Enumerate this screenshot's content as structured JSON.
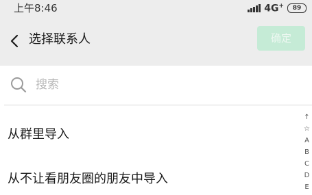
{
  "status_bar": {
    "time": "上午8:46",
    "network": "4G",
    "network_sup": "+",
    "battery": "89"
  },
  "header": {
    "title": "选择联系人",
    "confirm_label": "确定",
    "confirm_color": "#c5ebd6"
  },
  "search": {
    "placeholder": "搜索",
    "value": ""
  },
  "list": {
    "items": [
      {
        "label": "从群里导入"
      },
      {
        "label": "从不让看朋友圈的朋友中导入"
      }
    ]
  },
  "alpha_index": [
    "↑",
    "☆",
    "A",
    "B",
    "C",
    "D",
    "E"
  ],
  "colors": {
    "header_bg": "#ededed",
    "text": "#1a1a1a",
    "placeholder": "#b5b5b5"
  }
}
